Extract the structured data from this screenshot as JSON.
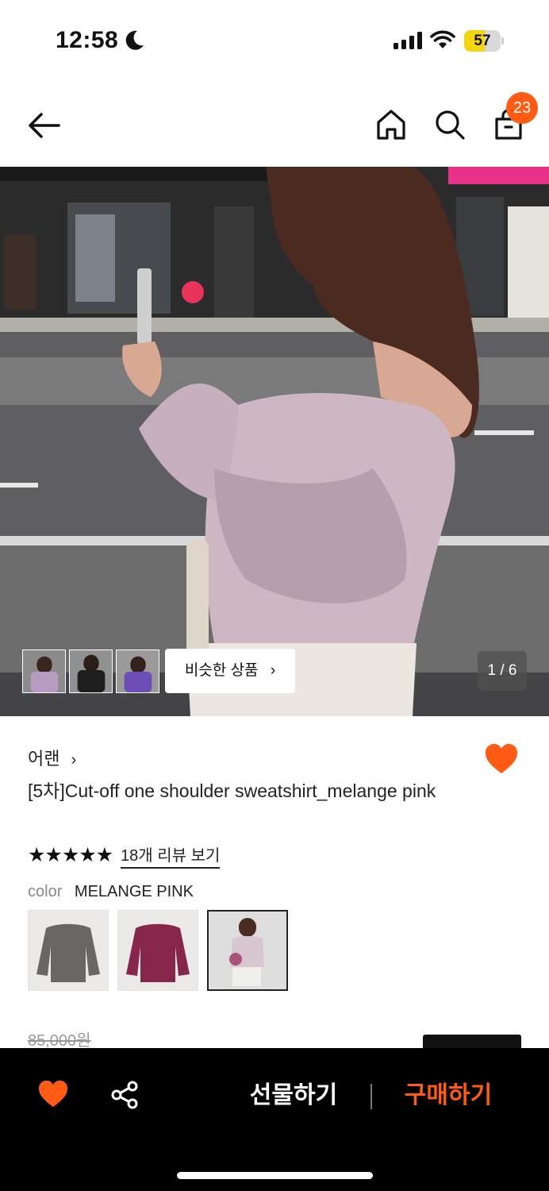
{
  "status_bar": {
    "time": "12:58",
    "battery": "57",
    "battery_level": 0.57
  },
  "nav": {
    "cart_badge": "23"
  },
  "gallery": {
    "similar_label": "비슷한 상품",
    "counter": "1 / 6"
  },
  "product": {
    "brand": "어랜",
    "title": "[5차]Cut-off one shoulder sweatshirt_melange pink",
    "rating_stars": 5,
    "stars_text": "★★★★★",
    "review_link": "18개 리뷰 보기",
    "color_label": "color",
    "color_value": "MELANGE PINK",
    "original_price": "85,000원"
  },
  "bottom_bar": {
    "gift_label": "선물하기",
    "buy_label": "구매하기"
  },
  "colors": {
    "accent": "#ff5b14",
    "battery_fill": "#f5d60d"
  }
}
